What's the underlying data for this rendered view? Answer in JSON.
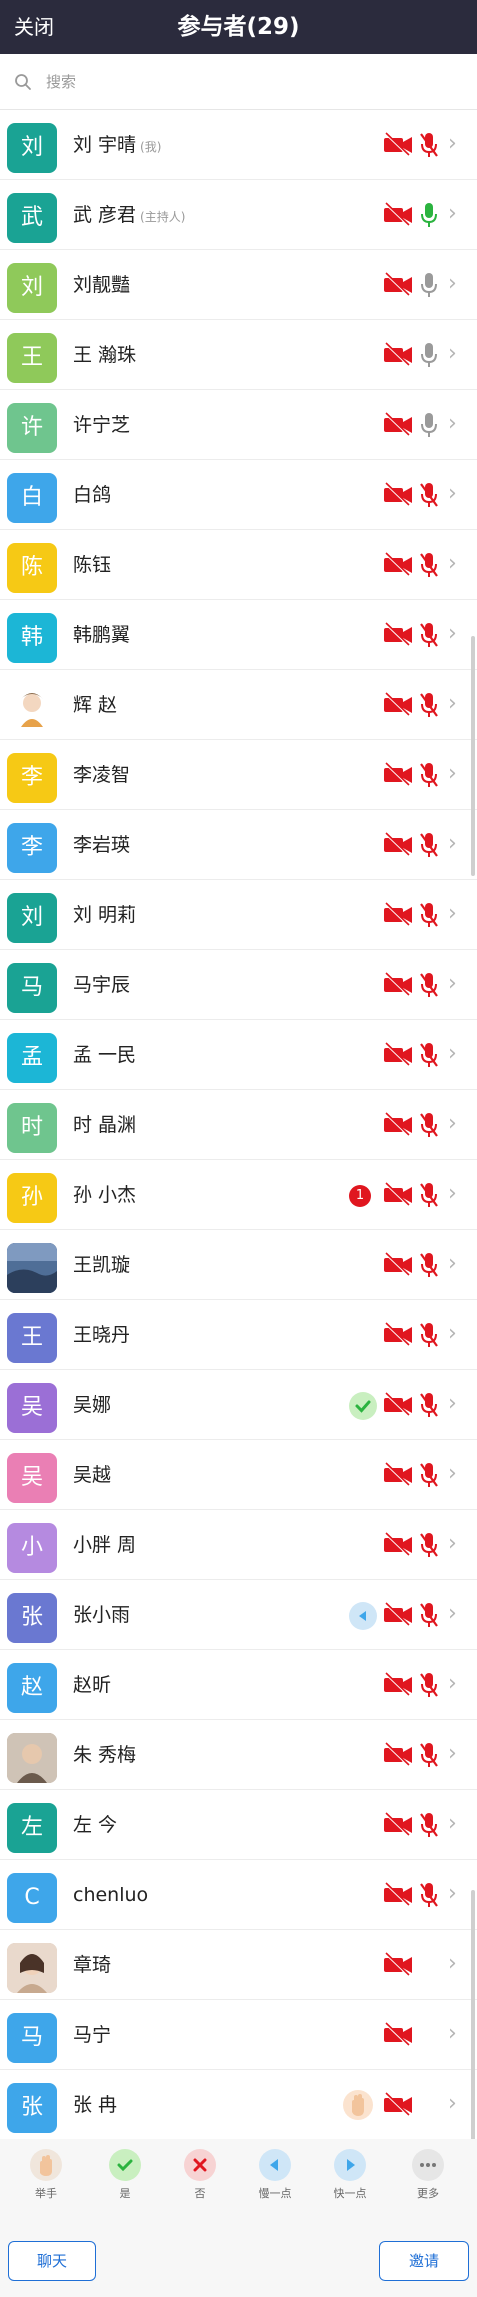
{
  "header": {
    "close_label": "关闭",
    "title": "参与者(29)"
  },
  "search": {
    "placeholder": "搜索",
    "icon": "search-icon"
  },
  "participants": [
    {
      "avatar": "刘",
      "color": "#1aa394",
      "name": "刘 宇晴",
      "tag": "(我)",
      "video": "off",
      "mic": "off"
    },
    {
      "avatar": "武",
      "color": "#1aa394",
      "name": "武 彦君",
      "tag": "(主持人)",
      "video": "off",
      "mic": "on-green"
    },
    {
      "avatar": "刘",
      "color": "#8fc95a",
      "name": "刘靓豔",
      "tag": "",
      "video": "off",
      "mic": "on-gray"
    },
    {
      "avatar": "王",
      "color": "#8fc95a",
      "name": "王 瀚珠",
      "tag": "",
      "video": "off",
      "mic": "on-gray"
    },
    {
      "avatar": "许",
      "color": "#6fc58e",
      "name": "许宁芝",
      "tag": "",
      "video": "off",
      "mic": "on-gray"
    },
    {
      "avatar": "白",
      "color": "#3ea6ea",
      "name": "白鸽",
      "tag": "",
      "video": "off",
      "mic": "off"
    },
    {
      "avatar": "陈",
      "color": "#f6c915",
      "name": "陈钰",
      "tag": "",
      "video": "off",
      "mic": "off"
    },
    {
      "avatar": "韩",
      "color": "#1cb6d6",
      "name": "韩鹏翼",
      "tag": "",
      "video": "off",
      "mic": "off"
    },
    {
      "avatar": "",
      "color": "#ffffff",
      "photo": "illustration-avatar",
      "name": "辉 赵",
      "tag": "",
      "video": "off",
      "mic": "off"
    },
    {
      "avatar": "李",
      "color": "#f6c915",
      "name": "李凌智",
      "tag": "",
      "video": "off",
      "mic": "off"
    },
    {
      "avatar": "李",
      "color": "#3ea6ea",
      "name": "李岩瑛",
      "tag": "",
      "video": "off",
      "mic": "off"
    },
    {
      "avatar": "刘",
      "color": "#1aa394",
      "name": "刘 明莉",
      "tag": "",
      "video": "off",
      "mic": "off"
    },
    {
      "avatar": "马",
      "color": "#1aa394",
      "name": "马宇辰",
      "tag": "",
      "video": "off",
      "mic": "off"
    },
    {
      "avatar": "孟",
      "color": "#1cb6d6",
      "name": "孟 一民",
      "tag": "",
      "video": "off",
      "mic": "off"
    },
    {
      "avatar": "时",
      "color": "#6fc58e",
      "name": "时 晶渊",
      "tag": "",
      "video": "off",
      "mic": "off"
    },
    {
      "avatar": "孙",
      "color": "#f6c915",
      "name": "孙 小杰",
      "tag": "",
      "video": "off",
      "mic": "off",
      "badge": "count",
      "badge_text": "1"
    },
    {
      "avatar": "",
      "color": "#3d5d8a",
      "photo": "landscape-avatar",
      "name": "王凯璇",
      "tag": "",
      "video": "off",
      "mic": "off"
    },
    {
      "avatar": "王",
      "color": "#6a78d1",
      "name": "王晓丹",
      "tag": "",
      "video": "off",
      "mic": "off"
    },
    {
      "avatar": "吴",
      "color": "#9b6fd6",
      "name": "吴娜",
      "tag": "",
      "video": "off",
      "mic": "off",
      "badge": "check"
    },
    {
      "avatar": "吴",
      "color": "#ea7fb4",
      "name": "吴越",
      "tag": "",
      "video": "off",
      "mic": "off"
    },
    {
      "avatar": "小",
      "color": "#b58ae0",
      "name": "小胖 周",
      "tag": "",
      "video": "off",
      "mic": "off"
    },
    {
      "avatar": "张",
      "color": "#6a78d1",
      "name": "张小雨",
      "tag": "",
      "video": "off",
      "mic": "off",
      "badge": "slower"
    },
    {
      "avatar": "赵",
      "color": "#3ea6ea",
      "name": "赵昕",
      "tag": "",
      "video": "off",
      "mic": "off"
    },
    {
      "avatar": "",
      "color": "#b8a99a",
      "photo": "person-avatar",
      "name": "朱 秀梅",
      "tag": "",
      "video": "off",
      "mic": "off"
    },
    {
      "avatar": "左",
      "color": "#1aa394",
      "name": "左 今",
      "tag": "",
      "video": "off",
      "mic": "off"
    },
    {
      "avatar": "C",
      "color": "#3ea6ea",
      "name": "chenluo",
      "tag": "",
      "video": "off",
      "mic": "off"
    },
    {
      "avatar": "",
      "color": "#d9c4b4",
      "photo": "portrait-avatar",
      "name": "章琦",
      "tag": "",
      "video": "off",
      "mic": "none"
    },
    {
      "avatar": "马",
      "color": "#3ea6ea",
      "name": "马宁",
      "tag": "",
      "video": "off",
      "mic": "none"
    },
    {
      "avatar": "张",
      "color": "#3ea6ea",
      "name": "张 冉",
      "tag": "",
      "video": "off",
      "mic": "none",
      "badge": "hand"
    }
  ],
  "actions": [
    {
      "label": "举手",
      "icon": "raise-hand-icon",
      "color": "#f0e6dc"
    },
    {
      "label": "是",
      "icon": "yes-check-icon",
      "color": "#c9efc0"
    },
    {
      "label": "否",
      "icon": "no-cross-icon",
      "color": "#f7d3d3"
    },
    {
      "label": "慢一点",
      "icon": "slower-icon",
      "color": "#cfe6f7"
    },
    {
      "label": "快一点",
      "icon": "faster-icon",
      "color": "#cfe6f7"
    },
    {
      "label": "更多",
      "icon": "more-icon",
      "color": "#e6e6e6"
    }
  ],
  "footer": {
    "chat_label": "聊天",
    "invite_label": "邀请"
  },
  "colors": {
    "header_bg": "#2b2b3d",
    "muted_red": "#e0161f",
    "accent_blue": "#1f6fd6",
    "mic_green": "#2bb33f"
  }
}
